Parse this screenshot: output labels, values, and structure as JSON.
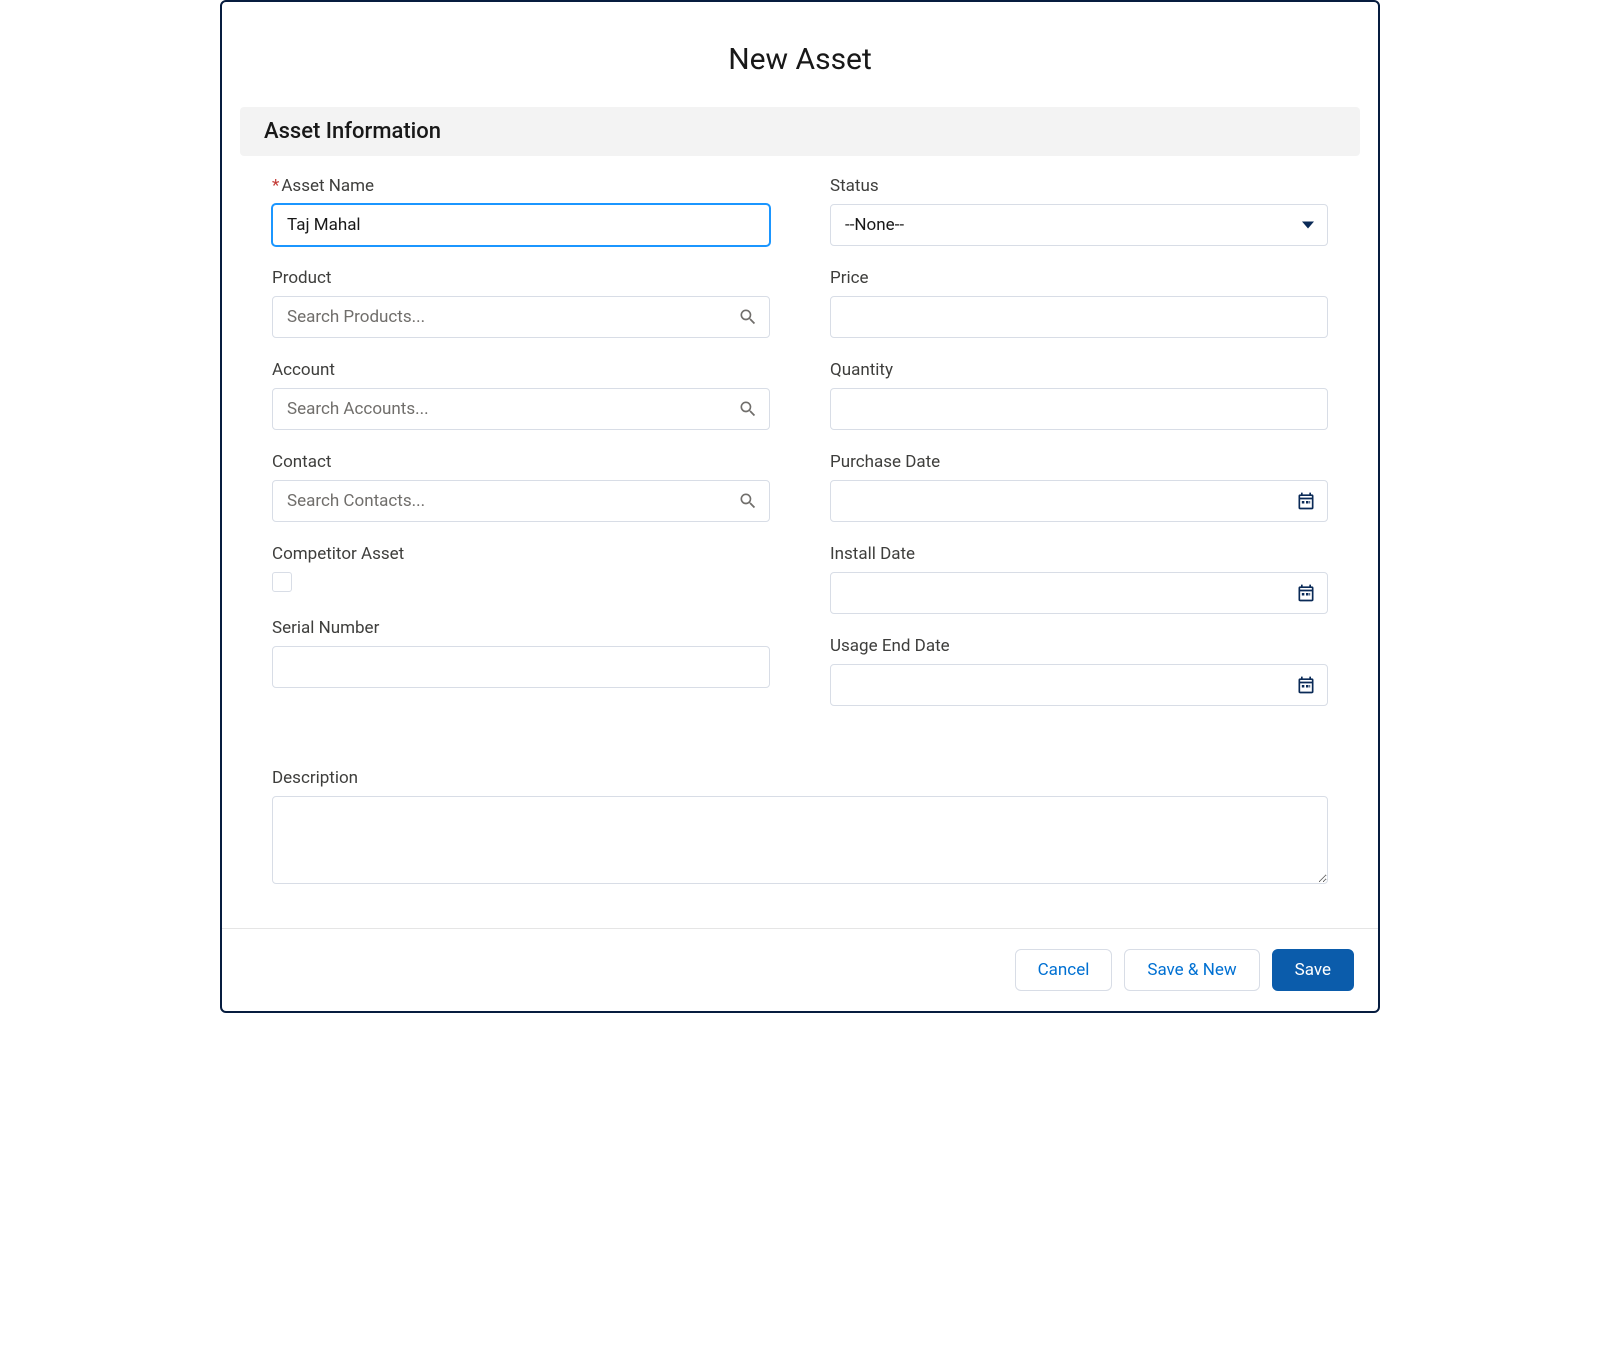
{
  "modal": {
    "title": "New Asset"
  },
  "section": {
    "title": "Asset Information"
  },
  "fields": {
    "assetName": {
      "label": "Asset Name",
      "value": "Taj Mahal",
      "required": "*"
    },
    "product": {
      "label": "Product",
      "placeholder": "Search Products..."
    },
    "account": {
      "label": "Account",
      "placeholder": "Search Accounts..."
    },
    "contact": {
      "label": "Contact",
      "placeholder": "Search Contacts..."
    },
    "competitorAsset": {
      "label": "Competitor Asset"
    },
    "serialNumber": {
      "label": "Serial Number",
      "value": ""
    },
    "status": {
      "label": "Status",
      "value": "--None--"
    },
    "price": {
      "label": "Price",
      "value": ""
    },
    "quantity": {
      "label": "Quantity",
      "value": ""
    },
    "purchaseDate": {
      "label": "Purchase Date",
      "value": ""
    },
    "installDate": {
      "label": "Install Date",
      "value": ""
    },
    "usageEndDate": {
      "label": "Usage End Date",
      "value": ""
    },
    "description": {
      "label": "Description",
      "value": ""
    }
  },
  "footer": {
    "cancel": "Cancel",
    "saveAndNew": "Save & New",
    "save": "Save"
  }
}
